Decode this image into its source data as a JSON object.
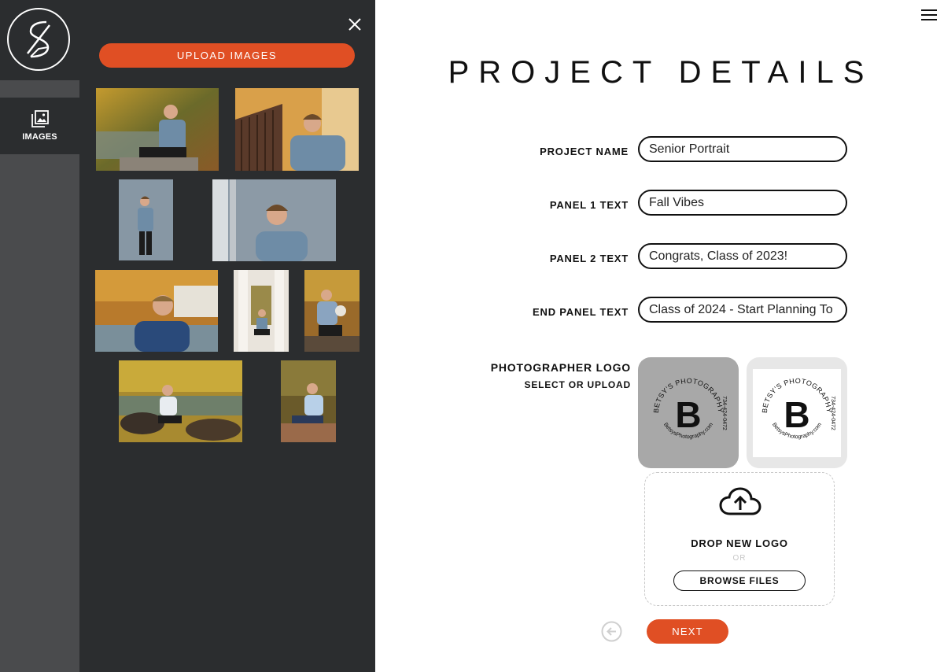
{
  "sidebar": {
    "images_tab_label": "IMAGES"
  },
  "images_panel": {
    "upload_label": "UPLOAD IMAGES"
  },
  "main": {
    "title": "PROJECT DETAILS",
    "fields": [
      {
        "label": "PROJECT NAME",
        "value": "Senior Portrait"
      },
      {
        "label": "PANEL 1 TEXT",
        "value": "Fall Vibes"
      },
      {
        "label": "PANEL 2 TEXT",
        "value": "Congrats, Class of 2023!"
      },
      {
        "label": "END PANEL TEXT",
        "value": "Class of 2024 - Start Planning To"
      }
    ],
    "logo": {
      "label": "PHOTOGRAPHER LOGO",
      "sublabel": "SELECT OR UPLOAD",
      "options": [
        {
          "brand": "BETSY'S PHOTOGRAPHY",
          "phone": "734-424-0472",
          "site": "BetsysPhotography.com",
          "letter": "B",
          "selected": true
        },
        {
          "brand": "BETSY'S PHOTOGRAPHY",
          "phone": "734-424-0472",
          "site": "BetsysPhotography.com",
          "letter": "B",
          "selected": false
        }
      ]
    },
    "dropzone": {
      "title": "DROP NEW LOGO",
      "or": "OR",
      "browse_label": "BROWSE FILES"
    },
    "next_label": "NEXT"
  },
  "colors": {
    "accent": "#e04f24",
    "panel_dark": "#2b2d2f",
    "rail_gray": "#4a4b4d"
  }
}
